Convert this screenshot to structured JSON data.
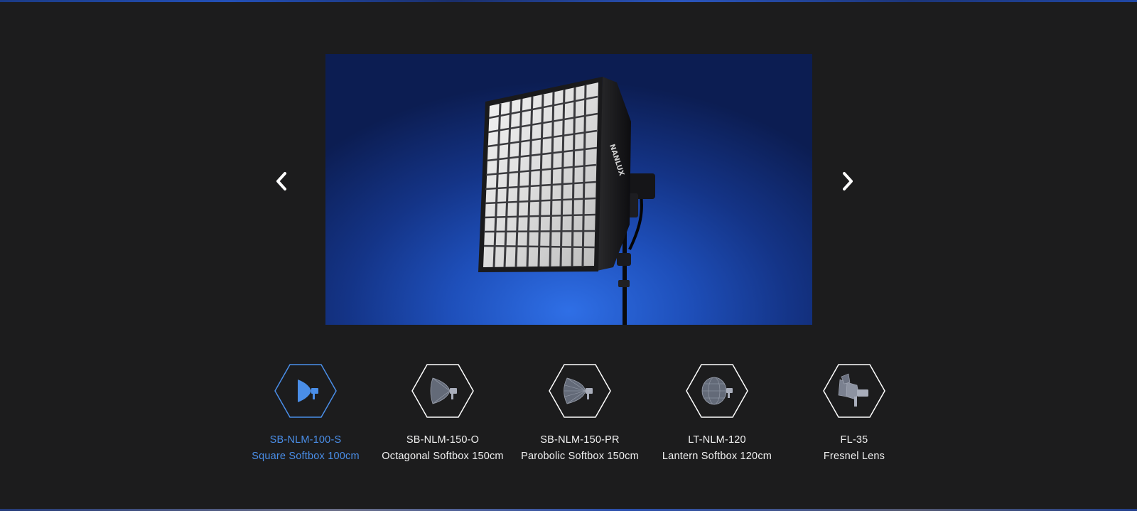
{
  "colors": {
    "background": "#1c1c1d",
    "accent": "#4a8ee8",
    "text": "#f1f1f1"
  },
  "hero": {
    "image": "softbox-on-light-stand-photo",
    "brand_mark": "NANLUX"
  },
  "carousel": {
    "prev_icon": "chevron-left-icon",
    "next_icon": "chevron-right-icon"
  },
  "accessories": [
    {
      "model": "SB-NLM-100-S",
      "name": "Square Softbox 100cm",
      "icon": "square-softbox-icon",
      "active": true
    },
    {
      "model": "SB-NLM-150-O",
      "name": "Octagonal Softbox 150cm",
      "icon": "octagonal-softbox-icon",
      "active": false
    },
    {
      "model": "SB-NLM-150-PR",
      "name": "Parobolic Softbox 150cm",
      "icon": "parabolic-softbox-icon",
      "active": false
    },
    {
      "model": "LT-NLM-120",
      "name": "Lantern Softbox 120cm",
      "icon": "lantern-softbox-icon",
      "active": false
    },
    {
      "model": "FL-35",
      "name": "Fresnel Lens",
      "icon": "fresnel-lens-icon",
      "active": false
    }
  ]
}
